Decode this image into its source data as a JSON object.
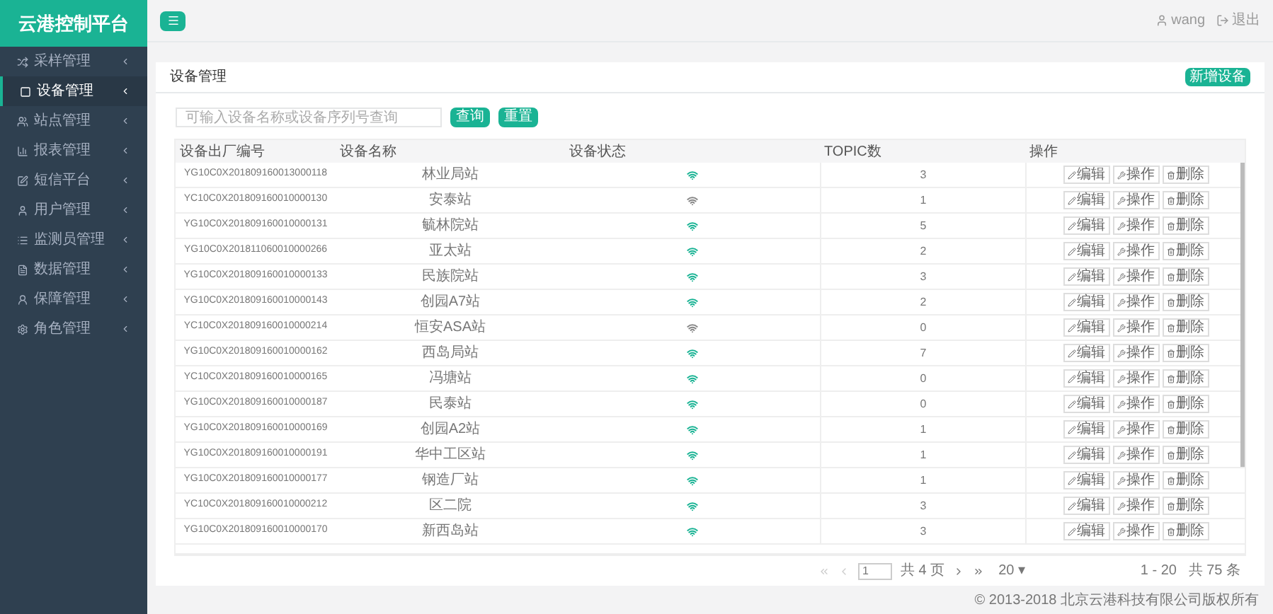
{
  "app": {
    "logo": "云港控制平台"
  },
  "sidebar": {
    "items": [
      {
        "label": "采样管理",
        "selected": false
      },
      {
        "label": "设备管理",
        "selected": true
      },
      {
        "label": "站点管理",
        "selected": false
      },
      {
        "label": "报表管理",
        "selected": false
      },
      {
        "label": "短信平台",
        "selected": false
      },
      {
        "label": "用户管理",
        "selected": false
      },
      {
        "label": "监测员管理",
        "selected": false
      },
      {
        "label": "数据管理",
        "selected": false
      },
      {
        "label": "保障管理",
        "selected": false
      },
      {
        "label": "角色管理",
        "selected": false
      }
    ]
  },
  "topbar": {
    "user": "wang",
    "logout": "退出"
  },
  "panel": {
    "title": "设备管理",
    "add_button": "新增设备",
    "search": {
      "placeholder": "可输入设备名称或设备序列号查询"
    },
    "search_buttons": [
      "查询",
      "重置"
    ],
    "table": {
      "columns": [
        "设备出厂编号",
        "设备名称",
        "设备状态",
        "TOPIC数",
        "操作"
      ],
      "rows": [
        {
          "serial": "YG10C0X201809160013000118",
          "name": "林业局站",
          "online": true,
          "topics": "3",
          "actions": [
            "编辑",
            "操作",
            "删除"
          ]
        },
        {
          "serial": "YC10C0X201809160010000130",
          "name": "安泰站",
          "online": false,
          "topics": "1",
          "actions": [
            "编辑",
            "操作",
            "删除"
          ]
        },
        {
          "serial": "YG10C0X201809160010000131",
          "name": "毓林院站",
          "online": true,
          "topics": "5",
          "actions": [
            "编辑",
            "操作",
            "删除"
          ]
        },
        {
          "serial": "YG10C0X201811060010000266",
          "name": "亚太站",
          "online": true,
          "topics": "2",
          "actions": [
            "编辑",
            "操作",
            "删除"
          ]
        },
        {
          "serial": "YG10C0X201809160010000133",
          "name": "民族院站",
          "online": true,
          "topics": "3",
          "actions": [
            "编辑",
            "操作",
            "删除"
          ]
        },
        {
          "serial": "YG10C0X201809160010000143",
          "name": "创园A7站",
          "online": true,
          "topics": "2",
          "actions": [
            "编辑",
            "操作",
            "删除"
          ]
        },
        {
          "serial": "YC10C0X201809160010000214",
          "name": "恒安ASA站",
          "online": false,
          "topics": "0",
          "actions": [
            "编辑",
            "操作",
            "删除"
          ]
        },
        {
          "serial": "YG10C0X201809160010000162",
          "name": "西岛局站",
          "online": true,
          "topics": "7",
          "actions": [
            "编辑",
            "操作",
            "删除"
          ]
        },
        {
          "serial": "YC10C0X201809160010000165",
          "name": "冯塘站",
          "online": true,
          "topics": "0",
          "actions": [
            "编辑",
            "操作",
            "删除"
          ]
        },
        {
          "serial": "YG10C0X201809160010000187",
          "name": "民泰站",
          "online": true,
          "topics": "0",
          "actions": [
            "编辑",
            "操作",
            "删除"
          ]
        },
        {
          "serial": "YG10C0X201809160010000169",
          "name": "创园A2站",
          "online": true,
          "topics": "1",
          "actions": [
            "编辑",
            "操作",
            "删除"
          ]
        },
        {
          "serial": "YG10C0X201809160010000191",
          "name": "华中工区站",
          "online": true,
          "topics": "1",
          "actions": [
            "编辑",
            "操作",
            "删除"
          ]
        },
        {
          "serial": "YG10C0X201809160010000177",
          "name": "钢造厂站",
          "online": true,
          "topics": "1",
          "actions": [
            "编辑",
            "操作",
            "删除"
          ]
        },
        {
          "serial": "YC10C0X201809160010000212",
          "name": "区二院",
          "online": true,
          "topics": "3",
          "actions": [
            "编辑",
            "操作",
            "删除"
          ]
        },
        {
          "serial": "YG10C0X201809160010000170",
          "name": "新西岛站",
          "online": true,
          "topics": "3",
          "actions": [
            "编辑",
            "操作",
            "删除"
          ]
        }
      ]
    },
    "pagination": {
      "page": "1",
      "total_pages": "共 4 页",
      "page_size": "20 ▾",
      "summary": "1 - 20   共 75 条"
    }
  },
  "footer": "© 2013-2018 北京云港科技有限公司版权所有"
}
